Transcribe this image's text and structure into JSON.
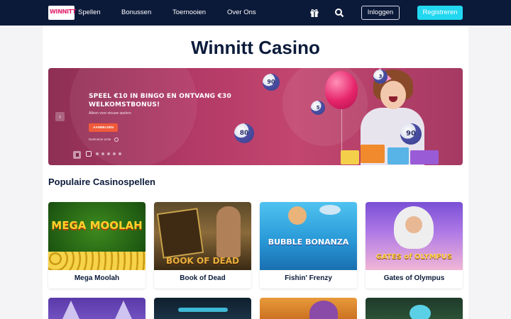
{
  "header": {
    "logo_text": "WINNITT",
    "nav": [
      "Spellen",
      "Bonussen",
      "Toernooien",
      "Over Ons"
    ],
    "icons": [
      "gift-icon",
      "search-icon"
    ],
    "login_label": "Inloggen",
    "register_label": "Registreren"
  },
  "page": {
    "title": "Winnitt Casino"
  },
  "hero": {
    "headline": "SPEEL €10 IN BINGO EN ONTVANG €30 WELKOMSTBONUS!",
    "subtext": "Alleen voor nieuwe spelers",
    "cta_label": "AANMELDEN",
    "terms_label": "Deelname actie",
    "ball_numbers": [
      "90",
      "80",
      "90",
      "3",
      "5"
    ],
    "slide_count": 6,
    "active_slide": 1
  },
  "section": {
    "title": "Populaire Casinospellen"
  },
  "games": [
    {
      "name": "Mega Moolah",
      "art": "MEGA MOOLAH"
    },
    {
      "name": "Book of Dead",
      "art": "BOOK OF DEAD"
    },
    {
      "name": "Fishin' Frenzy",
      "art": "BUBBLE BONANZA"
    },
    {
      "name": "Gates of Olympus",
      "art": "GATES of OLYMPUS"
    }
  ]
}
